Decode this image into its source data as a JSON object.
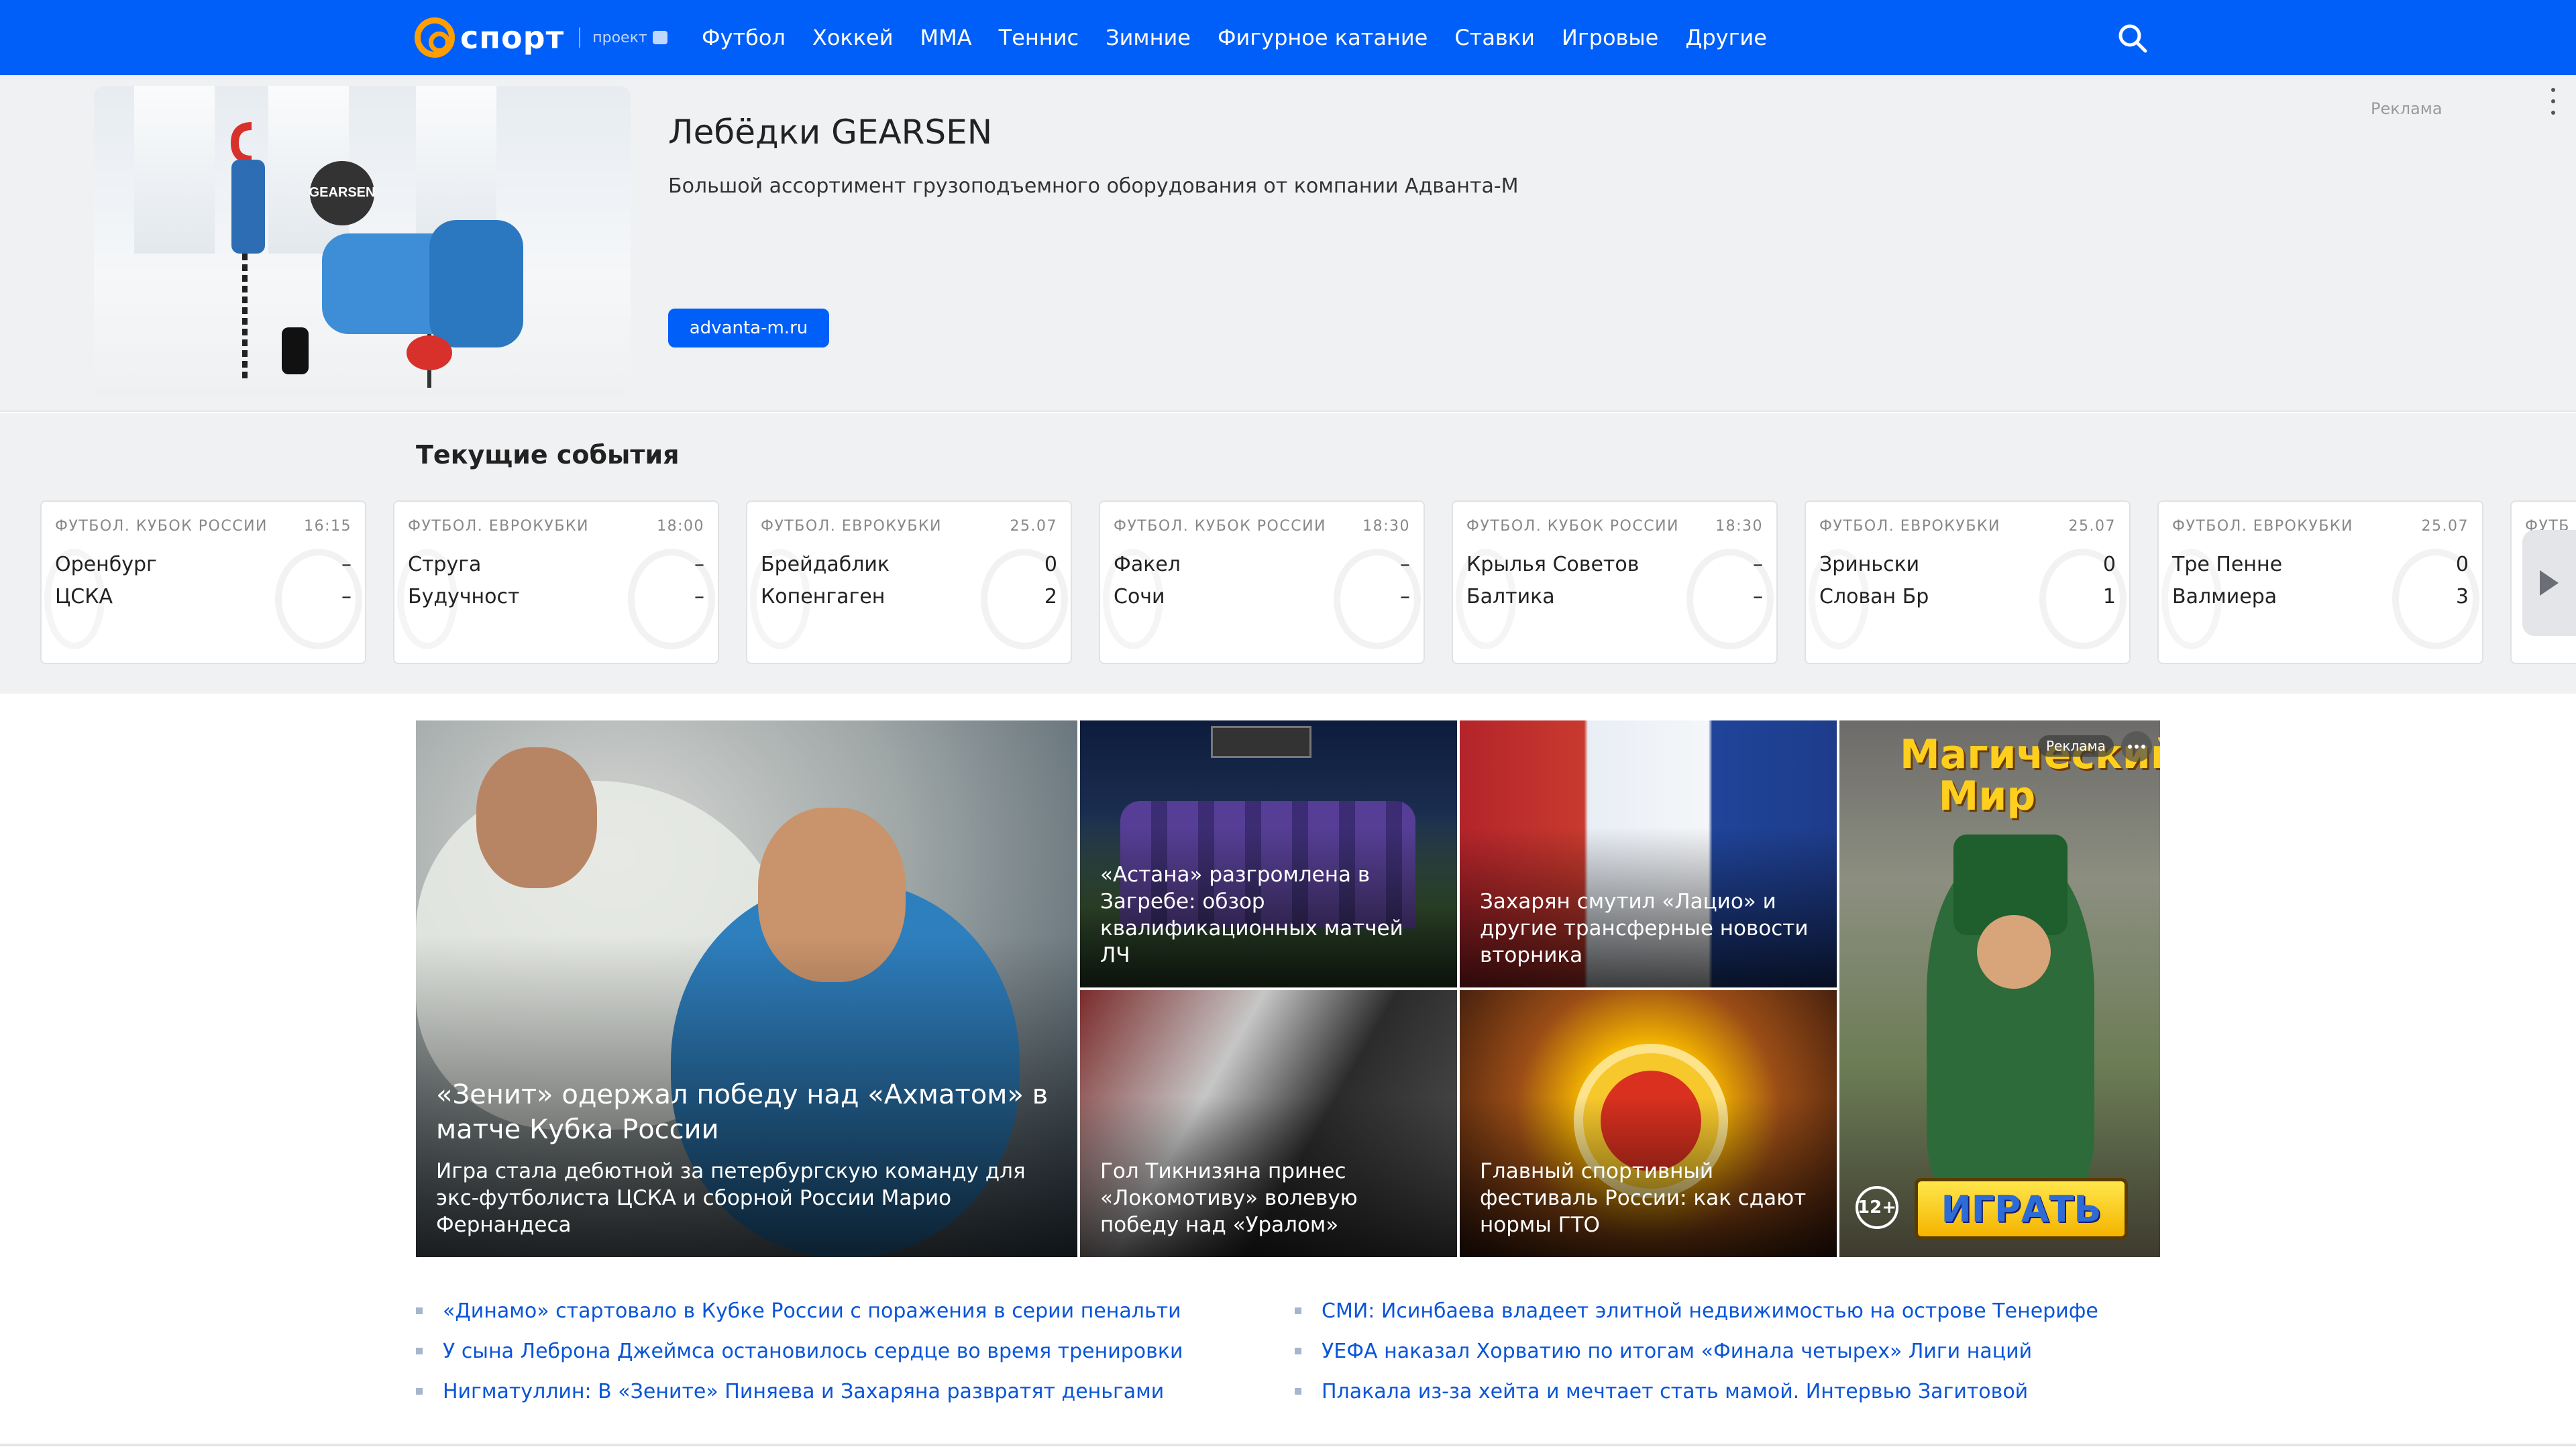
{
  "header": {
    "logo_word": "спорт",
    "logo_project": "проект",
    "nav": [
      "Футбол",
      "Хоккей",
      "ММА",
      "Теннис",
      "Зимние",
      "Фигурное катание",
      "Ставки",
      "Игровые",
      "Другие"
    ],
    "brand_color": "#005ff9",
    "search_icon": "search-icon"
  },
  "ad_banner": {
    "title": "Лебёдки GEARSEN",
    "description": "Большой ассортимент грузоподъемного оборудования от компании Адванта-М",
    "button": "advanta-m.ru",
    "label": "Реклама",
    "image_logo": "GEARSEN"
  },
  "events": {
    "title": "Текущие события",
    "cards": [
      {
        "league": "ФУТБОЛ. КУБОК РОССИИ",
        "time": "16:15",
        "team1": "Оренбург",
        "score1": "–",
        "team2": "ЦСКА",
        "score2": "–"
      },
      {
        "league": "ФУТБОЛ. ЕВРОКУБКИ",
        "time": "18:00",
        "team1": "Струга",
        "score1": "–",
        "team2": "Будучност",
        "score2": "–"
      },
      {
        "league": "ФУТБОЛ. ЕВРОКУБКИ",
        "time": "25.07",
        "team1": "Брейдаблик",
        "score1": "0",
        "team2": "Копенгаген",
        "score2": "2"
      },
      {
        "league": "ФУТБОЛ. КУБОК РОССИИ",
        "time": "18:30",
        "team1": "Факел",
        "score1": "–",
        "team2": "Сочи",
        "score2": "–"
      },
      {
        "league": "ФУТБОЛ. КУБОК РОССИИ",
        "time": "18:30",
        "team1": "Крылья Советов",
        "score1": "–",
        "team2": "Балтика",
        "score2": "–"
      },
      {
        "league": "ФУТБОЛ. ЕВРОКУБКИ",
        "time": "25.07",
        "team1": "Зриньски",
        "score1": "0",
        "team2": "Слован Бр",
        "score2": "1"
      },
      {
        "league": "ФУТБОЛ. ЕВРОКУБКИ",
        "time": "25.07",
        "team1": "Тре Пенне",
        "score1": "0",
        "team2": "Валмиера",
        "score2": "3"
      },
      {
        "league": "ФУТБ",
        "time": "",
        "team1": "",
        "score1": "",
        "team2": "",
        "score2": ""
      }
    ]
  },
  "news": {
    "main": {
      "title": "«Зенит» одержал победу над «Ахматом» в матче Кубка России",
      "subtitle": "Игра стала дебютной за петербургскую команду для экс-футболиста ЦСКА и сборной России Марио Фернандеса"
    },
    "astana": "«Астана» разгромлена в Загребе: обзор квалификационных матчей ЛЧ",
    "transfers": "Захарян смутил «Лацио» и другие трансферные новости вторника",
    "lokomotiv": "Гол Тикнизяна принес «Локомотиву» волевую победу над «Уралом»",
    "gto": "Главный спортивный фестиваль России: как сдают нормы ГТО",
    "game_ad": {
      "logo": "Магический Мир",
      "label": "Реклама",
      "age": "12+",
      "play": "ИГРАТЬ"
    }
  },
  "headlines": {
    "left": [
      "«Динамо» стартовало в Кубке России с поражения в серии пенальти",
      "У сына Леброна Джеймса остановилось сердце во время тренировки",
      "Нигматуллин: В «Зените» Пиняева и Захаряна развратят деньгами"
    ],
    "right": [
      "СМИ: Исинбаева владеет элитной недвижимостью на острове Тенерифе",
      "УЕФА наказал Хорватию по итогам «Финала четырех» Лиги наций",
      "Плакала из-за хейта и мечтает стать мамой. Интервью Загитовой"
    ]
  }
}
